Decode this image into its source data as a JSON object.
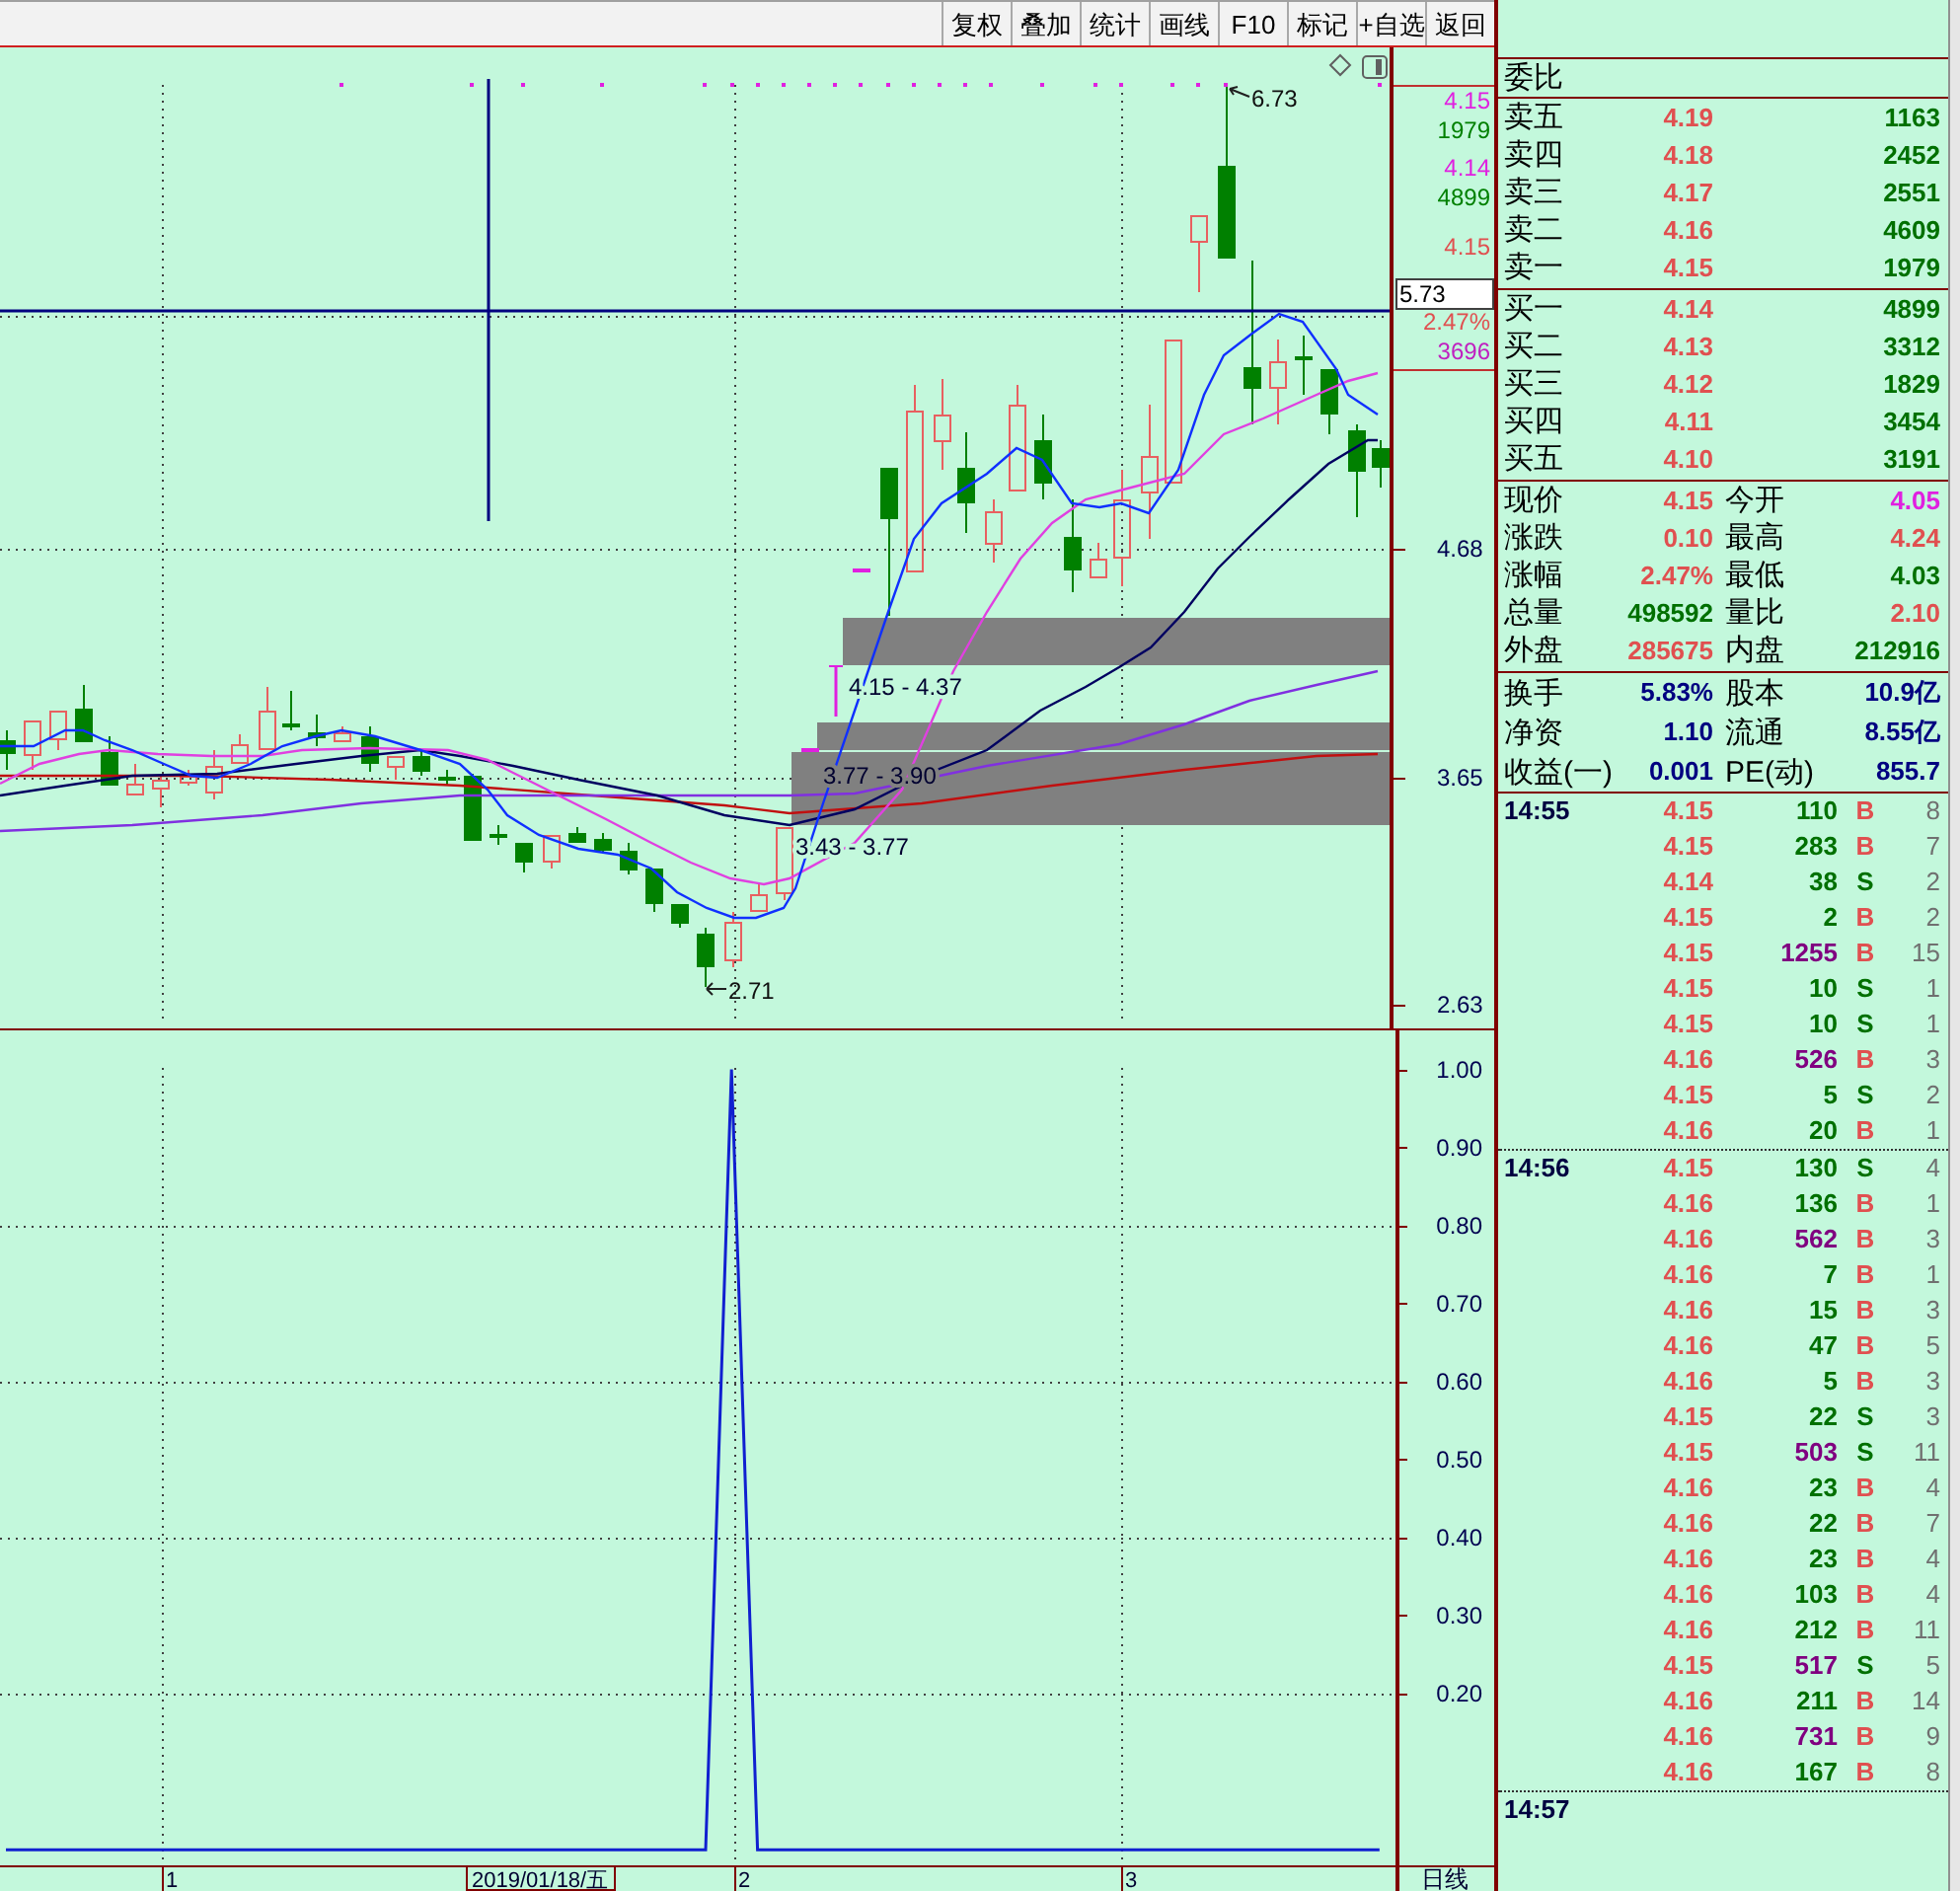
{
  "toolbar": {
    "buttons": [
      "复权",
      "叠加",
      "统计",
      "画线",
      "F10",
      "标记",
      "+自选",
      "返回"
    ]
  },
  "main_chart": {
    "zones": [
      {
        "label": "4.15 - 4.37"
      },
      {
        "label": "3.77 - 3.90"
      },
      {
        "label": "3.43 - 3.77"
      }
    ],
    "high_label": "6.73",
    "low_label": "2.71",
    "price_axis": [
      "4.68",
      "3.65",
      "2.63"
    ],
    "cursor_price": "5.73",
    "info_box": [
      {
        "text": "4.15",
        "color": "#e020e0"
      },
      {
        "text": "1979",
        "color": "#008000"
      },
      {
        "text": "4.14",
        "color": "#e020e0"
      },
      {
        "text": "4899",
        "color": "#008000"
      },
      {
        "text": "4.15",
        "color": "#e05050"
      },
      {
        "text": "2.47%",
        "color": "#e05050"
      },
      {
        "text": "3696",
        "color": "#c020c0"
      }
    ]
  },
  "indicator_chart": {
    "chart_data": {
      "type": "line",
      "grid": true,
      "ylim": [
        -0.02,
        1.05
      ],
      "yticks": [
        {
          "value": 1,
          "label": "1.00"
        },
        {
          "value": 0.9,
          "label": "0.90"
        },
        {
          "value": 0.8,
          "label": "0.80"
        },
        {
          "value": 0.7,
          "label": "0.70"
        },
        {
          "value": 0.6,
          "label": "0.60"
        },
        {
          "value": 0.5,
          "label": "0.50"
        },
        {
          "value": 0.4,
          "label": "0.40"
        },
        {
          "value": 0.3,
          "label": "0.30"
        },
        {
          "value": 0.2,
          "label": "0.20"
        }
      ],
      "series": [
        {
          "color": "#1020d0",
          "values": [
            0,
            0,
            0,
            0,
            0,
            0,
            0,
            0,
            0,
            0,
            0,
            0,
            0,
            0,
            0,
            0,
            0,
            0,
            0,
            0,
            0,
            0,
            0,
            0,
            0,
            0,
            0,
            0,
            1,
            0,
            0,
            0,
            0,
            0,
            0,
            0,
            0,
            0,
            0,
            0,
            0,
            0,
            0,
            0,
            0,
            0,
            0,
            0,
            0,
            0,
            0,
            0,
            0,
            0
          ]
        }
      ]
    }
  },
  "time_axis": {
    "labels": [
      "1",
      "2",
      "3"
    ],
    "cursor_date": "2019/01/18/五",
    "period": "日线"
  },
  "quote_panel": {
    "ratio_label": "委比",
    "asks": [
      {
        "label": "卖五",
        "price": "4.19",
        "volume": "1163"
      },
      {
        "label": "卖四",
        "price": "4.18",
        "volume": "2452"
      },
      {
        "label": "卖三",
        "price": "4.17",
        "volume": "2551"
      },
      {
        "label": "卖二",
        "price": "4.16",
        "volume": "4609"
      },
      {
        "label": "卖一",
        "price": "4.15",
        "volume": "1979"
      }
    ],
    "bids": [
      {
        "label": "买一",
        "price": "4.14",
        "volume": "4899"
      },
      {
        "label": "买二",
        "price": "4.13",
        "volume": "3312"
      },
      {
        "label": "买三",
        "price": "4.12",
        "volume": "1829"
      },
      {
        "label": "买四",
        "price": "4.11",
        "volume": "3454"
      },
      {
        "label": "买五",
        "price": "4.10",
        "volume": "3191"
      }
    ],
    "stats": [
      {
        "label": "现价",
        "value": "4.15",
        "color": "#e05050"
      },
      {
        "label": "今开",
        "value": "4.05",
        "color": "#e020e0"
      },
      {
        "label": "涨跌",
        "value": "0.10",
        "color": "#e05050"
      },
      {
        "label": "最高",
        "value": "4.24",
        "color": "#e05050"
      },
      {
        "label": "涨幅",
        "value": "2.47%",
        "color": "#e05050"
      },
      {
        "label": "最低",
        "value": "4.03",
        "color": "#007000"
      },
      {
        "label": "总量",
        "value": "498592",
        "color": "#007000"
      },
      {
        "label": "量比",
        "value": "2.10",
        "color": "#e05050"
      },
      {
        "label": "外盘",
        "value": "285675",
        "color": "#e05050"
      },
      {
        "label": "内盘",
        "value": "212916",
        "color": "#007000"
      }
    ],
    "fundamentals": [
      {
        "label": "换手",
        "value": "5.83%"
      },
      {
        "label": "股本",
        "value": "10.9亿"
      },
      {
        "label": "净资",
        "value": "1.10"
      },
      {
        "label": "流通",
        "value": "8.55亿"
      },
      {
        "label": "收益(一)",
        "value": "0.001"
      },
      {
        "label": "PE(动)",
        "value": "855.7"
      }
    ]
  },
  "trades": [
    {
      "time": "14:55",
      "rows": [
        {
          "price": "4.15",
          "volume": "110",
          "large": false,
          "side": "B",
          "kind": "buy",
          "count": "8"
        },
        {
          "price": "4.15",
          "volume": "283",
          "large": false,
          "side": "B",
          "kind": "buy",
          "count": "7"
        },
        {
          "price": "4.14",
          "volume": "38",
          "large": false,
          "side": "S",
          "kind": "sell",
          "count": "2"
        },
        {
          "price": "4.15",
          "volume": "2",
          "large": false,
          "side": "B",
          "kind": "buy",
          "count": "2"
        },
        {
          "price": "4.15",
          "volume": "1255",
          "large": true,
          "side": "B",
          "kind": "buy",
          "count": "15"
        },
        {
          "price": "4.15",
          "volume": "10",
          "large": false,
          "side": "S",
          "kind": "sell",
          "count": "1"
        },
        {
          "price": "4.15",
          "volume": "10",
          "large": false,
          "side": "S",
          "kind": "sell",
          "count": "1"
        },
        {
          "price": "4.16",
          "volume": "526",
          "large": true,
          "side": "B",
          "kind": "buy",
          "count": "3"
        },
        {
          "price": "4.15",
          "volume": "5",
          "large": false,
          "side": "S",
          "kind": "sell",
          "count": "2"
        },
        {
          "price": "4.16",
          "volume": "20",
          "large": false,
          "side": "B",
          "kind": "buy",
          "count": "1"
        }
      ]
    },
    {
      "time": "14:56",
      "rows": [
        {
          "price": "4.15",
          "volume": "130",
          "large": false,
          "side": "S",
          "kind": "sell",
          "count": "4"
        },
        {
          "price": "4.16",
          "volume": "136",
          "large": false,
          "side": "B",
          "kind": "buy",
          "count": "1"
        },
        {
          "price": "4.16",
          "volume": "562",
          "large": true,
          "side": "B",
          "kind": "buy",
          "count": "3"
        },
        {
          "price": "4.16",
          "volume": "7",
          "large": false,
          "side": "B",
          "kind": "buy",
          "count": "1"
        },
        {
          "price": "4.16",
          "volume": "15",
          "large": false,
          "side": "B",
          "kind": "buy",
          "count": "3"
        },
        {
          "price": "4.16",
          "volume": "47",
          "large": false,
          "side": "B",
          "kind": "buy",
          "count": "5"
        },
        {
          "price": "4.16",
          "volume": "5",
          "large": false,
          "side": "B",
          "kind": "buy",
          "count": "3"
        },
        {
          "price": "4.15",
          "volume": "22",
          "large": false,
          "side": "S",
          "kind": "sell",
          "count": "3"
        },
        {
          "price": "4.15",
          "volume": "503",
          "large": true,
          "side": "S",
          "kind": "sell",
          "count": "11"
        },
        {
          "price": "4.16",
          "volume": "23",
          "large": false,
          "side": "B",
          "kind": "buy",
          "count": "4"
        },
        {
          "price": "4.16",
          "volume": "22",
          "large": false,
          "side": "B",
          "kind": "buy",
          "count": "7"
        },
        {
          "price": "4.16",
          "volume": "23",
          "large": false,
          "side": "B",
          "kind": "buy",
          "count": "4"
        },
        {
          "price": "4.16",
          "volume": "103",
          "large": false,
          "side": "B",
          "kind": "buy",
          "count": "4"
        },
        {
          "price": "4.16",
          "volume": "212",
          "large": false,
          "side": "B",
          "kind": "buy",
          "count": "11"
        },
        {
          "price": "4.15",
          "volume": "517",
          "large": true,
          "side": "S",
          "kind": "sell",
          "count": "5"
        },
        {
          "price": "4.16",
          "volume": "211",
          "large": false,
          "side": "B",
          "kind": "buy",
          "count": "14"
        },
        {
          "price": "4.16",
          "volume": "731",
          "large": true,
          "side": "B",
          "kind": "buy",
          "count": "9"
        },
        {
          "price": "4.16",
          "volume": "167",
          "large": false,
          "side": "B",
          "kind": "buy",
          "count": "8"
        }
      ]
    },
    {
      "time": "14:57"
    }
  ]
}
